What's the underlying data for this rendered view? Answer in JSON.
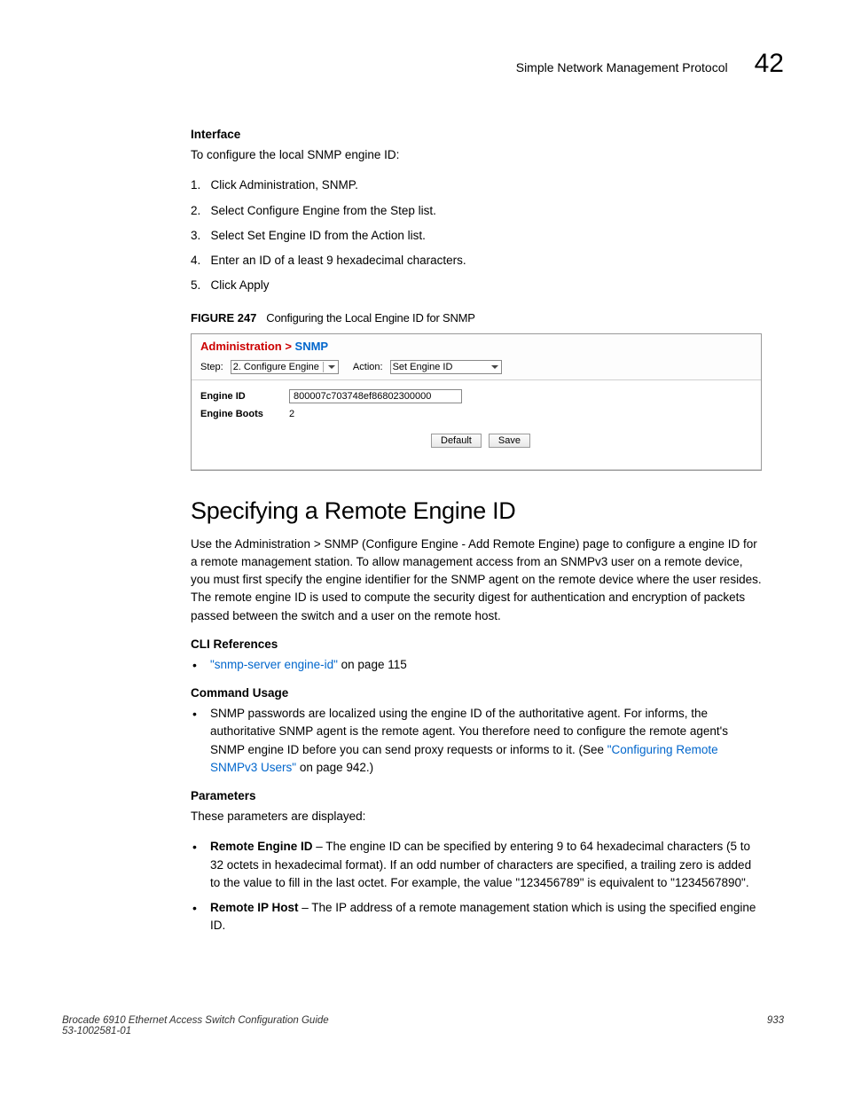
{
  "header": {
    "title": "Simple Network Management Protocol",
    "chapter": "42"
  },
  "interface": {
    "heading": "Interface",
    "intro": "To configure the local SNMP engine ID:",
    "steps": [
      "Click Administration, SNMP.",
      "Select Configure Engine from the Step list.",
      "Select Set Engine ID from the Action list.",
      "Enter an ID of a least 9 hexadecimal characters.",
      "Click Apply"
    ]
  },
  "figure": {
    "number": "FIGURE 247",
    "title": "Configuring the Local Engine ID for SNMP"
  },
  "screenshot": {
    "breadcrumb_prefix": "Administration > ",
    "breadcrumb_page": "SNMP",
    "step_label": "Step:",
    "step_value": "2. Configure Engine",
    "action_label": "Action:",
    "action_value": "Set Engine ID",
    "engine_id_label": "Engine ID",
    "engine_id_value": "800007c703748ef86802300000",
    "engine_boots_label": "Engine Boots",
    "engine_boots_value": "2",
    "btn_default": "Default",
    "btn_save": "Save"
  },
  "section2": {
    "title": "Specifying a Remote Engine ID",
    "intro": "Use the Administration > SNMP (Configure Engine - Add Remote Engine) page to configure a engine ID for a remote management station. To allow management access from an SNMPv3 user on a remote device, you must first specify the engine identifier for the SNMP agent on the remote device where the user resides. The remote engine ID is used to compute the security digest for authentication and encryption of packets passed between the switch and a user on the remote host.",
    "cli_heading": "CLI References",
    "cli_link": "\"snmp-server engine-id\"",
    "cli_suffix": " on page 115",
    "cmd_heading": "Command Usage",
    "cmd_text1": "SNMP passwords are localized using the engine ID of the authoritative agent. For informs, the authoritative SNMP agent is the remote agent. You therefore need to configure the remote agent's SNMP engine ID before you can send proxy requests or informs to it. (See ",
    "cmd_link": "\"Configuring Remote SNMPv3 Users\"",
    "cmd_text2": " on page 942.)",
    "params_heading": "Parameters",
    "params_intro": "These parameters are displayed:",
    "param1_name": "Remote Engine ID",
    "param1_desc": " – The engine ID can be specified by entering 9 to 64 hexadecimal characters (5 to 32 octets in hexadecimal format). If an odd number of characters are specified, a trailing zero is added to the value to fill in the last octet. For example, the value \"123456789\" is equivalent to \"1234567890\".",
    "param2_name": "Remote IP Host",
    "param2_desc": " – The IP address of a remote management station which is using the specified engine ID."
  },
  "footer": {
    "line1": "Brocade 6910 Ethernet Access Switch Configuration Guide",
    "line2": "53-1002581-01",
    "page": "933"
  }
}
